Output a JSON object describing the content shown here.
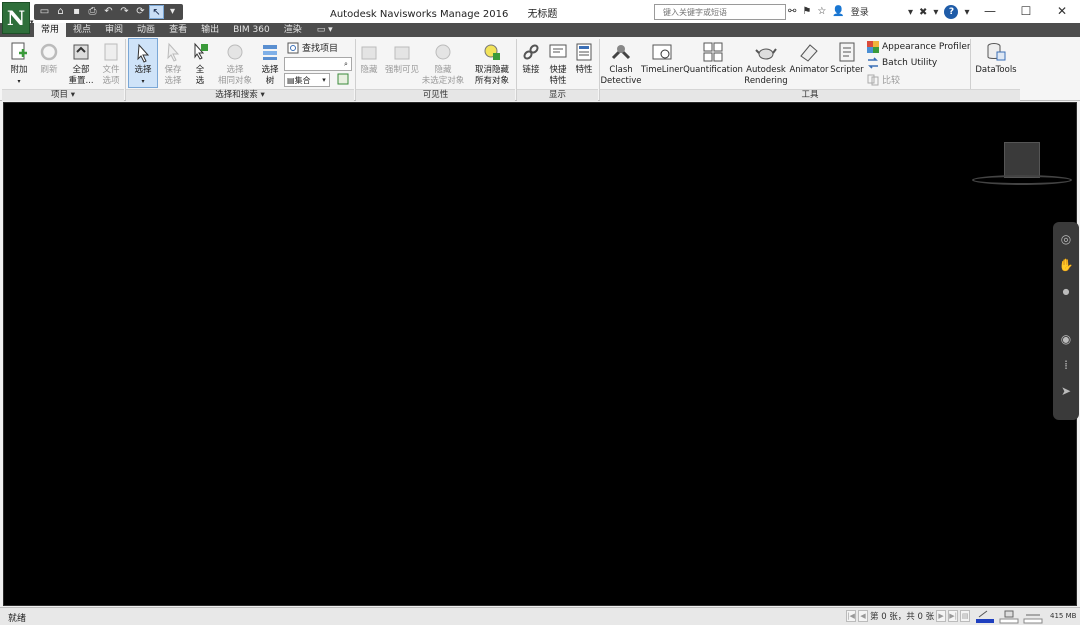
{
  "window": {
    "title": "Autodesk Navisworks Manage 2016",
    "document": "无标题",
    "controls": [
      "—",
      "☐",
      "✕"
    ]
  },
  "app_menu": {
    "logo": "N"
  },
  "search": {
    "placeholder": "键入关键字或短语"
  },
  "account": {
    "login": "登录"
  },
  "tabs": [
    "常用",
    "视点",
    "审阅",
    "动画",
    "查看",
    "输出",
    "BIM 360",
    "渲染"
  ],
  "active_tab": "常用",
  "ribbon": {
    "project": {
      "append": "附加",
      "refresh": "刷新",
      "reset_all_1": "全部",
      "reset_all_2": "重置...",
      "file_opts_1": "文件",
      "file_opts_2": "选项",
      "label": "项目 ▾"
    },
    "select_search": {
      "select": "选择",
      "save_sel_1": "保存",
      "save_sel_2": "选择",
      "select_all_1": "全",
      "select_all_2": "选",
      "select_same_1": "选择",
      "select_same_2": "相同对象",
      "sel_tree_1": "选择",
      "sel_tree_2": "树",
      "find_items": "查找项目",
      "sets_combo": "集合",
      "label": "选择和搜索 ▾"
    },
    "visibility": {
      "hide": "隐藏",
      "require": "强制可见",
      "hide_unsel_1": "隐藏",
      "hide_unsel_2": "未选定对象",
      "unhide_1": "取消隐藏",
      "unhide_2": "所有对象",
      "label": "可见性"
    },
    "display": {
      "links": "链接",
      "quick_props_1": "快捷",
      "quick_props_2": "特性",
      "properties": "特性",
      "label": "显示"
    },
    "tools": {
      "clash_1": "Clash",
      "clash_2": "Detective",
      "timeliner": "TimeLiner",
      "quantification": "Quantification",
      "rendering_1": "Autodesk",
      "rendering_2": "Rendering",
      "animator": "Animator",
      "scripter": "Scripter",
      "appearance_profiler": "Appearance Profiler",
      "batch_utility": "Batch Utility",
      "compare": "比较",
      "datatools": "DataTools",
      "label": "工具"
    }
  },
  "status": {
    "ready": "就绪",
    "pages": "第 0 张，共 0 张",
    "memory": "415 MB"
  },
  "colors": {
    "logo_green": "#2f6f3b",
    "selected_blue": "#cfe3f8",
    "viewport_bg": "#000000"
  }
}
